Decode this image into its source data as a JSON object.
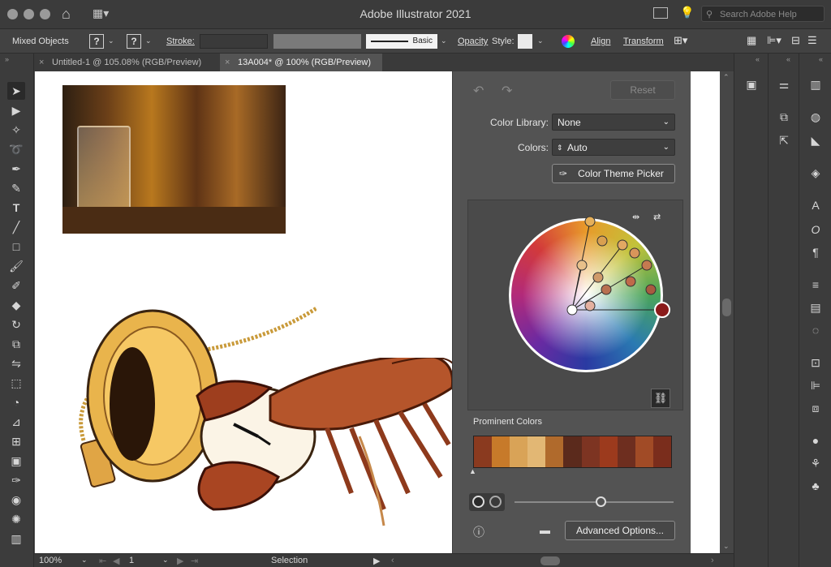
{
  "app": {
    "title": "Adobe Illustrator 2021",
    "search_placeholder": "Search Adobe Help"
  },
  "controlbar": {
    "selection_label": "Mixed Objects",
    "fill_box": "?",
    "stroke_box": "?",
    "stroke_label": "Stroke:",
    "brush_label": "Basic",
    "opacity_label": "Opacity",
    "style_label": "Style:",
    "align_label": "Align",
    "transform_label": "Transform"
  },
  "tabs": [
    {
      "label": "Untitled-1 @ 105.08% (RGB/Preview)"
    },
    {
      "label": "13A004* @ 100% (RGB/Preview)"
    }
  ],
  "color_panel": {
    "reset_label": "Reset",
    "color_library_label": "Color Library:",
    "color_library_value": "None",
    "colors_label": "Colors:",
    "colors_value": "Auto",
    "picker_button": "Color Theme Picker",
    "prominent_label": "Prominent Colors",
    "prominent_swatches": [
      "#8a3a1f",
      "#c77a2a",
      "#d9a357",
      "#e2b774",
      "#b06a2c",
      "#5b2a1c",
      "#7d3422",
      "#9c3a1d",
      "#6e2e1f",
      "#a14b26",
      "#7a2d1c"
    ],
    "advanced_button": "Advanced Options..."
  },
  "statusbar": {
    "zoom": "100%",
    "artboard": "1",
    "tool": "Selection"
  },
  "icons": {
    "left_tools": [
      "selection-tool-icon",
      "direct-selection-tool-icon",
      "magic-wand-icon",
      "lasso-icon",
      "pen-icon",
      "curvature-icon",
      "type-icon",
      "line-icon",
      "rectangle-icon",
      "paintbrush-icon",
      "shaper-icon",
      "eraser-icon",
      "rotate-icon",
      "scale-icon",
      "width-icon",
      "free-transform-icon",
      "shape-builder-icon",
      "perspective-icon",
      "mesh-icon",
      "gradient-icon",
      "eyedropper-icon",
      "blend-icon",
      "symbol-sprayer-icon",
      "graph-icon"
    ]
  }
}
